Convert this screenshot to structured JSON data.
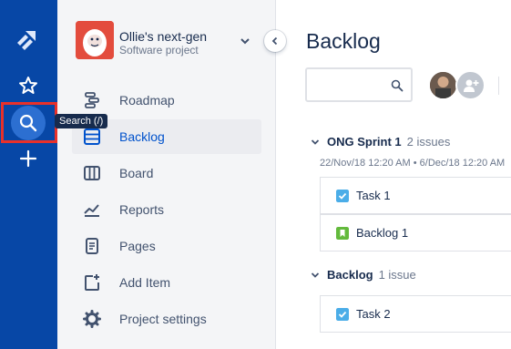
{
  "tooltip": "Search (/)",
  "project": {
    "name": "Ollie's next-gen",
    "type": "Software project"
  },
  "nav": {
    "items": [
      {
        "label": "Roadmap"
      },
      {
        "label": "Backlog"
      },
      {
        "label": "Board"
      },
      {
        "label": "Reports"
      },
      {
        "label": "Pages"
      },
      {
        "label": "Add Item"
      },
      {
        "label": "Project settings"
      }
    ]
  },
  "main": {
    "title": "Backlog",
    "search_value": "",
    "sprint": {
      "name": "ONG Sprint 1",
      "count": "2 issues",
      "dates": "22/Nov/18 12:20 AM • 6/Dec/18 12:20 AM"
    },
    "sprint_issues": [
      {
        "label": "Task 1",
        "type": "task"
      },
      {
        "label": "Backlog 1",
        "type": "story"
      }
    ],
    "backlog": {
      "name": "Backlog",
      "count": "1 issue"
    },
    "backlog_issues": [
      {
        "label": "Task 2",
        "type": "task"
      }
    ]
  },
  "colors": {
    "global_nav": "#0747a6",
    "highlight": "#e8312a",
    "task": "#4bade8",
    "story": "#63ba3c",
    "active_text": "#0052cc"
  }
}
